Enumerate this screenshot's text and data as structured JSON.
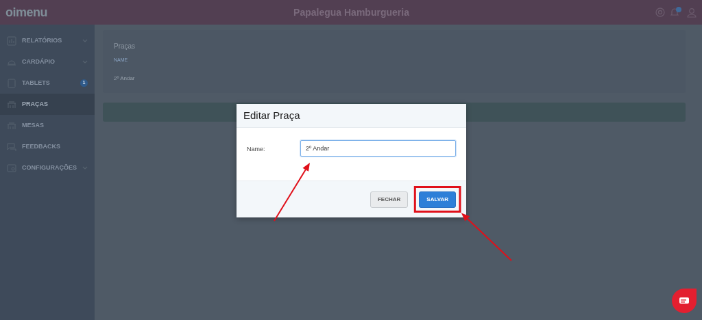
{
  "header": {
    "logo": "oimenu",
    "title": "Papalegua Hamburgueria",
    "notification_dot": true
  },
  "sidebar": {
    "items": [
      {
        "label": "RELATÓRIOS",
        "kind": "group",
        "selected": false
      },
      {
        "label": "CARDÁPIO",
        "kind": "group",
        "selected": false
      },
      {
        "label": "TABLETS",
        "kind": "badge",
        "badge": "1",
        "selected": false
      },
      {
        "label": "PRAÇAS",
        "kind": "link",
        "selected": true
      },
      {
        "label": "MESAS",
        "kind": "link",
        "selected": false
      },
      {
        "label": "FEEDBACKS",
        "kind": "link",
        "selected": false
      },
      {
        "label": "CONFIGURAÇÕES",
        "kind": "group",
        "selected": false
      }
    ]
  },
  "card": {
    "title": "Praças",
    "columns": [
      "NAME"
    ],
    "rows": [
      [
        "2º Andar"
      ]
    ]
  },
  "modal": {
    "title": "Editar Praça",
    "field_label": "Name:",
    "value": "2º Andar",
    "focused": true,
    "buttons": [
      {
        "label": "FECHAR",
        "kind": "secondary"
      },
      {
        "label": "SALVAR",
        "kind": "primary"
      }
    ]
  },
  "annotations": [
    {
      "kind": "arrow"
    },
    {
      "kind": "highlight"
    },
    {
      "kind": "arrow"
    }
  ]
}
